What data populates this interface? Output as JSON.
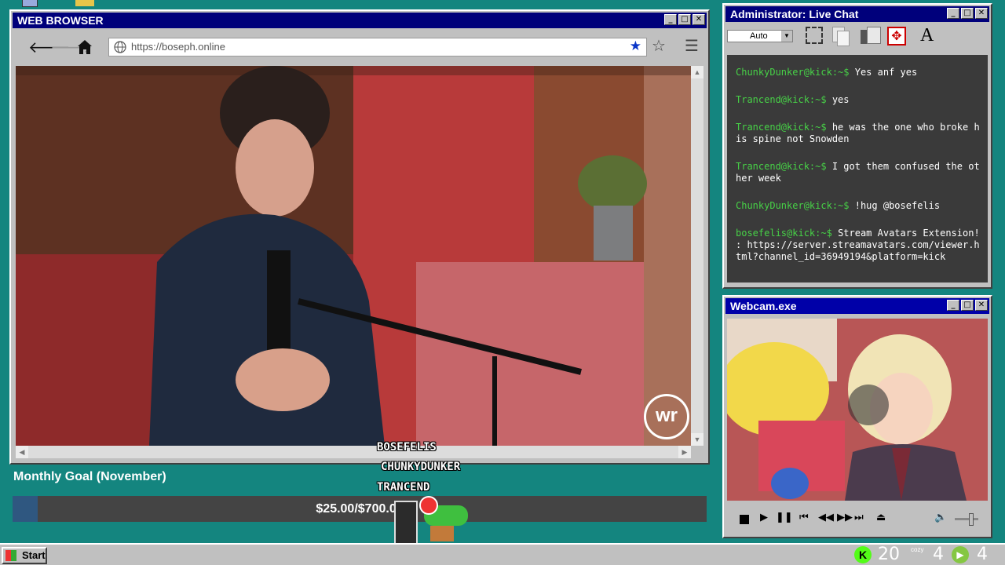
{
  "browser": {
    "title": "WEB BROWSER",
    "url": "https://boseph.online",
    "video_logo": "wr"
  },
  "chat": {
    "title": "Administrator: Live Chat",
    "font_select": "Auto",
    "messages": [
      {
        "user": "ChunkyDunker@kick:~$",
        "text": "Yes anf yes"
      },
      {
        "user": "Trancend@kick:~$",
        "text": "yes"
      },
      {
        "user": "Trancend@kick:~$",
        "text": "he was the one who broke his spine not Snowden"
      },
      {
        "user": "Trancend@kick:~$",
        "text": "I got them confused the other week"
      },
      {
        "user": "ChunkyDunker@kick:~$",
        "text": "!hug @bosefelis"
      },
      {
        "user": "bosefelis@kick:~$",
        "text": "Stream Avatars Extension! : https://server.streamavatars.com/viewer.html?channel_id=36949194&platform=kick"
      }
    ]
  },
  "webcam": {
    "title": "Webcam.exe"
  },
  "goal": {
    "label": "Monthly Goal (November)",
    "amount": "$25.00/$700.00",
    "progress_fraction": 0.0357
  },
  "avatars": [
    "BOSEFELIS",
    "CHUNKYDUNKER",
    "TRANCEND"
  ],
  "taskbar": {
    "start_label": "Start",
    "kick_count": "20",
    "cozy_label": "cozy",
    "cozy_count": "4",
    "rumble_count": "4"
  }
}
